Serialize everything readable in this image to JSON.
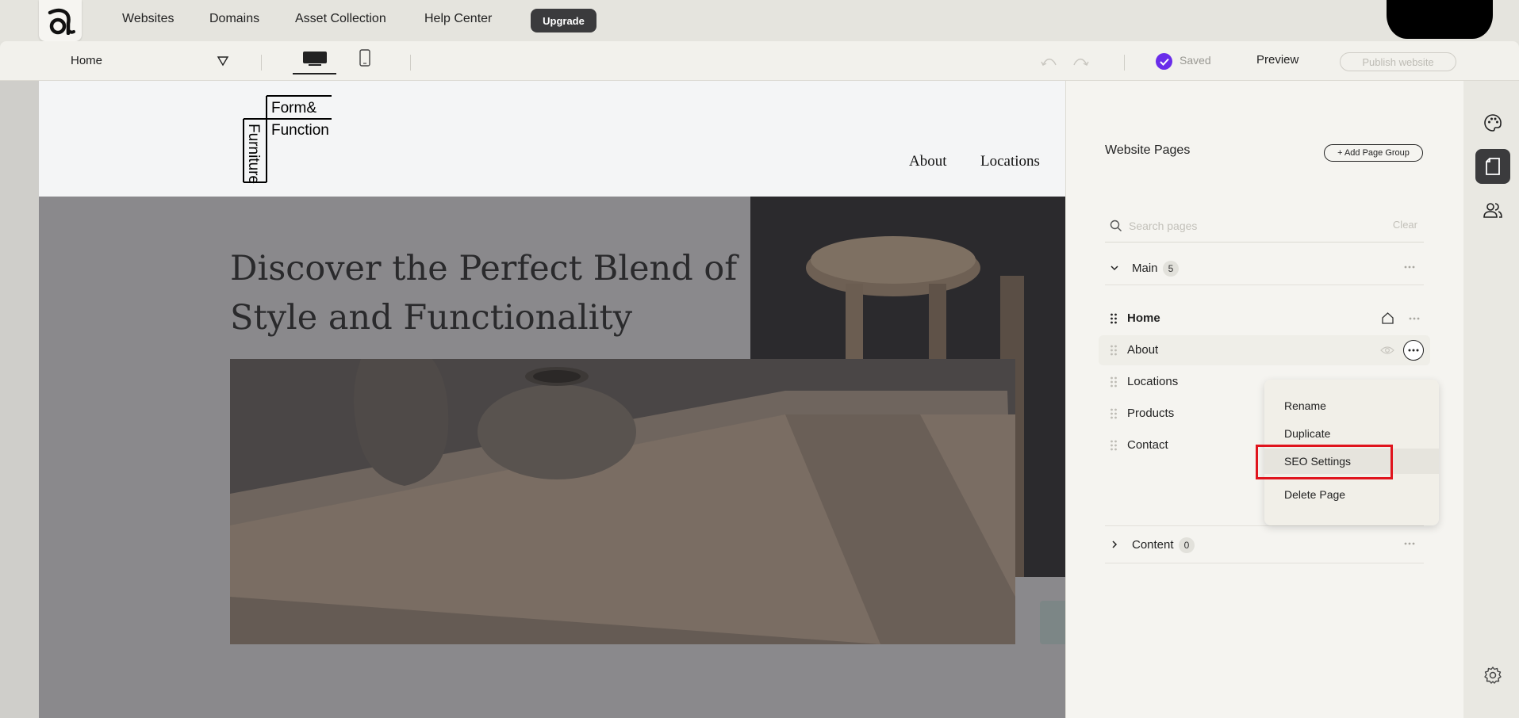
{
  "topnav": {
    "logo_icon": "ampersand-a-logo-icon",
    "links": [
      "Websites",
      "Domains",
      "Asset Collection",
      "Help Center"
    ],
    "upgrade_label": "Upgrade"
  },
  "toolbar": {
    "current_page": "Home",
    "devices": [
      "desktop-icon",
      "mobile-icon"
    ],
    "saved_label": "Saved",
    "preview_label": "Preview",
    "publish_label": "Publish website",
    "accent_color": "#6a2dea"
  },
  "site": {
    "logo_text": [
      "Form&",
      "Function",
      "Furniture"
    ],
    "nav": [
      "About",
      "Locations"
    ],
    "hero_title": "Discover the Perfect Blend of Style and Functionality"
  },
  "panel": {
    "title": "Website Pages",
    "add_group_label": "+ Add Page Group",
    "search_placeholder": "Search pages",
    "clear_label": "Clear",
    "groups": [
      {
        "label": "Main",
        "count": "5",
        "expanded": true
      },
      {
        "label": "Content",
        "count": "0",
        "expanded": false
      }
    ],
    "pages": [
      "Home",
      "About",
      "Locations",
      "Products",
      "Contact"
    ]
  },
  "context_menu": {
    "items": [
      "Rename",
      "Duplicate",
      "SEO Settings",
      "Delete Page"
    ],
    "highlight_color": "#e0141d"
  },
  "rail": {
    "icons": [
      "palette-icon",
      "page-icon",
      "users-icon",
      "gear-icon"
    ]
  }
}
